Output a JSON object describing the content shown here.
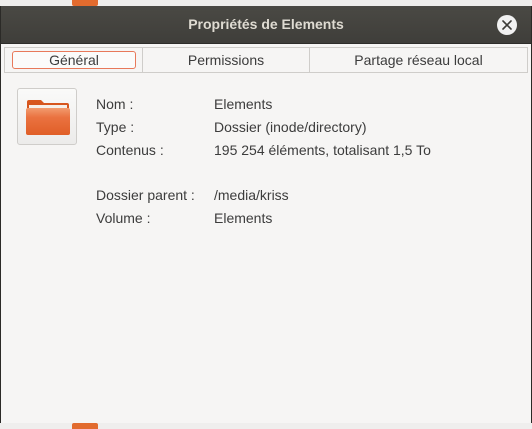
{
  "window": {
    "title": "Propriétés de Elements"
  },
  "tabs": [
    {
      "label": "Général",
      "active": true
    },
    {
      "label": "Permissions",
      "active": false
    },
    {
      "label": "Partage réseau local",
      "active": false
    }
  ],
  "general": {
    "icon": "folder-icon",
    "properties": [
      {
        "label": "Nom :",
        "value": "Elements"
      },
      {
        "label": "Type :",
        "value": "Dossier (inode/directory)"
      },
      {
        "label": "Contenus :",
        "value": "195 254 éléments, totalisant 1,5 To"
      },
      {
        "label": "Dossier parent :",
        "value": "/media/kriss"
      },
      {
        "label": "Volume :",
        "value": "Elements"
      }
    ]
  },
  "colors": {
    "accent": "#e8795a",
    "folder": "#e2622a",
    "titlebar": "#45443f"
  }
}
